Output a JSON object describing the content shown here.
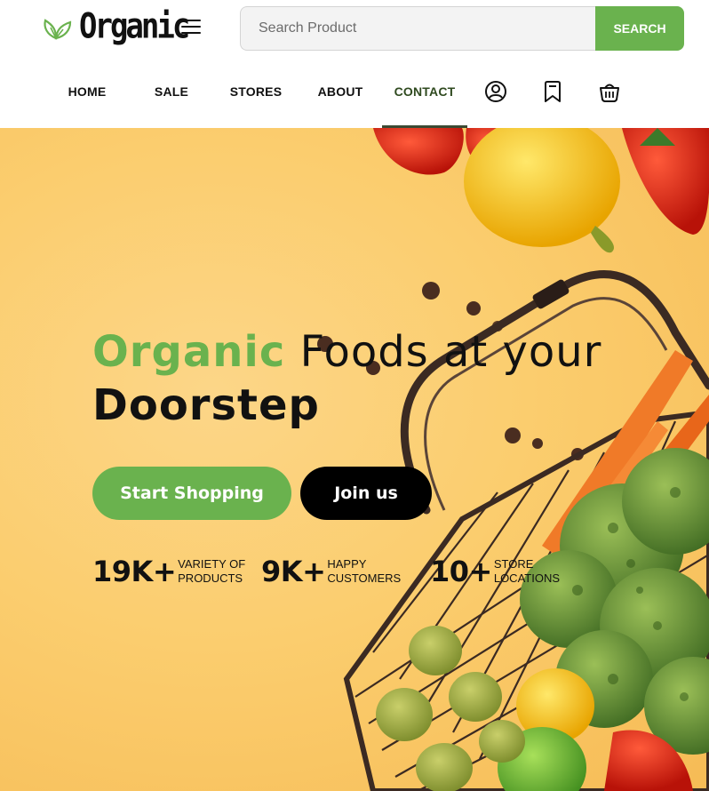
{
  "brand": {
    "name": "Organic",
    "accent": "#6ab24e"
  },
  "search": {
    "placeholder": "Search Product",
    "button_label": "SEARCH"
  },
  "nav": {
    "items": [
      {
        "label": "HOME"
      },
      {
        "label": "SALE"
      },
      {
        "label": "STORES"
      },
      {
        "label": "ABOUT"
      },
      {
        "label": "CONTACT",
        "active": true
      }
    ],
    "icons": [
      "user-icon",
      "bookmark-icon",
      "basket-icon"
    ]
  },
  "hero": {
    "title_green": "Organic",
    "title_rest": "Foods at your",
    "title_line2": "Doorstep",
    "start_button": "Start Shopping",
    "join_button": "Join us",
    "stats": [
      {
        "number": "19K+",
        "label_line1": "VARIETY OF",
        "label_line2": "PRODUCTS"
      },
      {
        "number": "9K+",
        "label_line1": "HAPPY",
        "label_line2": "CUSTOMERS"
      },
      {
        "number": "10+",
        "label_line1": "STORE",
        "label_line2": "LOCATIONS"
      }
    ]
  }
}
